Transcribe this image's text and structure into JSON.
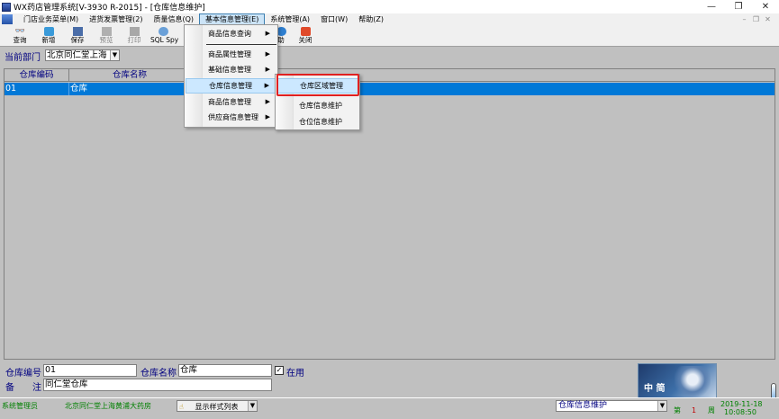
{
  "window": {
    "title": "WX药店管理系统[V-3930 R-2015] - [仓库信息维护]",
    "controls": [
      "—",
      "❐",
      "✕"
    ]
  },
  "menubar": {
    "items": [
      "门店业务菜单(M)",
      "进货发票管理(2)",
      "质量信息(Q)",
      "基本信息管理(E)",
      "系统管理(A)",
      "窗口(W)",
      "帮助(Z)"
    ],
    "mdi_controls": [
      "–",
      "❐",
      "✕"
    ]
  },
  "toolbar": {
    "query": "查询",
    "add": "新增",
    "save": "保存",
    "preview": "预览",
    "print": "打印",
    "sqlspy": "SQL Spy",
    "help": "助",
    "close": "关闭"
  },
  "dept": {
    "label": "当前部门",
    "value": "北京同仁堂上海"
  },
  "grid": {
    "columns": [
      "仓库编码",
      "仓库名称"
    ],
    "rows": [
      {
        "code": "01",
        "name": "仓库"
      }
    ]
  },
  "detail": {
    "code_label": "仓库编号",
    "code_value": "01",
    "name_label": "仓库名称",
    "name_value": "仓库",
    "enabled_label": "在用",
    "enabled_check": "✓",
    "remark_label_1": "备",
    "remark_label_2": "注",
    "remark_value": "同仁堂仓库"
  },
  "menu_basic": {
    "items": [
      "商品信息查询",
      "商品属性管理",
      "基础信息管理",
      "仓库信息管理",
      "商品信息管理",
      "供应商信息管理"
    ]
  },
  "menu_warehouse": {
    "items": [
      "仓库区域管理",
      "仓库信息维护",
      "仓位信息维护"
    ]
  },
  "statusbar": {
    "user": "系统管理员",
    "store": "北京同仁堂上海黄浦大药房",
    "display_mode": "显示样式列表",
    "window_name": "仓库信息维护",
    "ime_text": "中 简",
    "week_label": "第",
    "week_no": "1",
    "week_suffix": "周",
    "date": "2019-11-18",
    "time": "10:08:50"
  }
}
